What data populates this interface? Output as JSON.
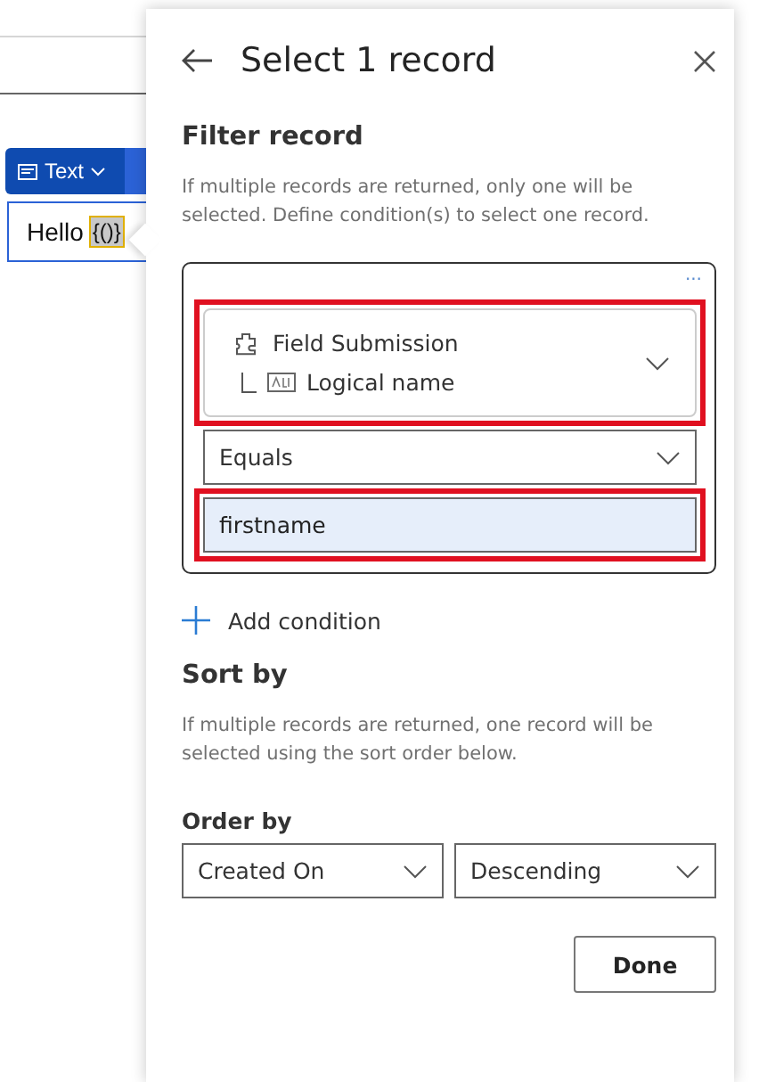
{
  "editor": {
    "format_button": {
      "label": "Text"
    },
    "content": {
      "text": "Hello",
      "token": "{()}"
    }
  },
  "panel": {
    "title": "Select 1 record",
    "filter": {
      "heading": "Filter record",
      "description": "If multiple records are returned, only one will be selected. Define condition(s) to select one record.",
      "condition": {
        "more": "...",
        "field": {
          "entity": "Field Submission",
          "attribute": "Logical name",
          "highlighted": true
        },
        "operator": "Equals",
        "value": {
          "text": "firstname",
          "highlighted": true
        }
      },
      "add_label": "Add condition"
    },
    "sort": {
      "heading": "Sort by",
      "description": "If multiple records are returned, one record will be selected using the sort order below.",
      "order_label": "Order by",
      "order_field": "Created On",
      "direction": "Descending"
    },
    "done": "Done"
  }
}
